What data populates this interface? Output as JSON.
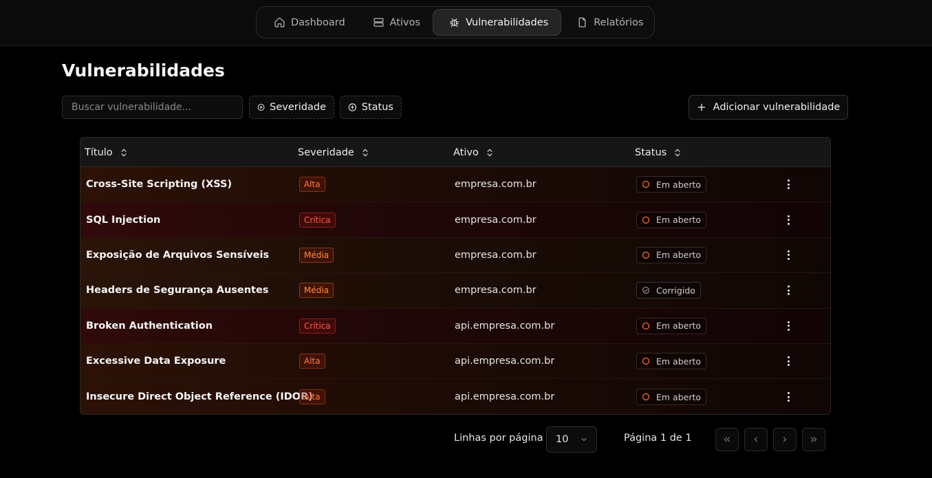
{
  "nav": {
    "items": [
      {
        "label": "Dashboard",
        "icon": "home-icon"
      },
      {
        "label": "Ativos",
        "icon": "server-icon"
      },
      {
        "label": "Vulnerabilidades",
        "icon": "bug-icon",
        "active": true
      },
      {
        "label": "Relatórios",
        "icon": "file-icon"
      }
    ]
  },
  "page": {
    "title": "Vulnerabilidades"
  },
  "toolbar": {
    "search_placeholder": "Buscar vulnerabilidade...",
    "filter_severity": "Severidade",
    "filter_status": "Status",
    "add_label": "Adicionar vulnerabilidade"
  },
  "table": {
    "columns": [
      "Título",
      "Severidade",
      "Ativo",
      "Status"
    ],
    "rows": [
      {
        "title": "Cross-Site Scripting (XSS)",
        "severity": "Alta",
        "asset": "empresa.com.br",
        "status": "Em aberto"
      },
      {
        "title": "SQL Injection",
        "severity": "Crítica",
        "asset": "empresa.com.br",
        "status": "Em aberto"
      },
      {
        "title": "Exposição de Arquivos Sensíveis",
        "severity": "Média",
        "asset": "empresa.com.br",
        "status": "Em aberto"
      },
      {
        "title": "Headers de Segurança Ausentes",
        "severity": "Média",
        "asset": "empresa.com.br",
        "status": "Corrigido"
      },
      {
        "title": "Broken Authentication",
        "severity": "Crítica",
        "asset": "api.empresa.com.br",
        "status": "Em aberto"
      },
      {
        "title": "Excessive Data Exposure",
        "severity": "Alta",
        "asset": "api.empresa.com.br",
        "status": "Em aberto"
      },
      {
        "title": "Insecure Direct Object Reference (IDOR)",
        "severity": "Alta",
        "asset": "api.empresa.com.br",
        "status": "Em aberto"
      }
    ]
  },
  "pagination": {
    "rows_label": "Linhas por página",
    "rows_value": "10",
    "page_info": "Página 1 de 1"
  },
  "colors": {
    "alta": "#ff7a45",
    "critica": "#ff5a4a",
    "media": "#ff8c40",
    "status_open": "#ff6a2a",
    "status_fixed": "#9a9a9a"
  }
}
